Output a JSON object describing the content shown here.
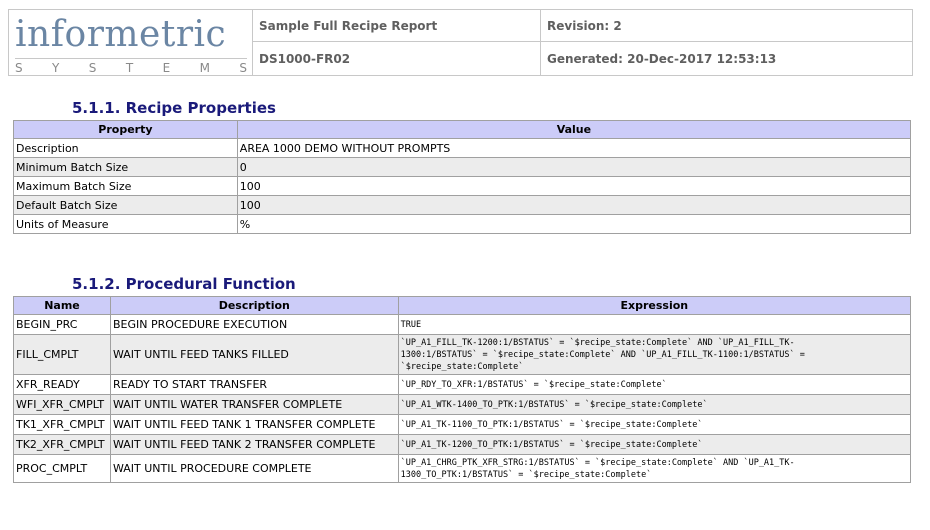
{
  "header": {
    "logo_word": "informetric",
    "logo_sub": [
      "S",
      "Y",
      "S",
      "T",
      "E",
      "M",
      "S"
    ],
    "report_title": "Sample Full Recipe Report",
    "revision": "Revision: 2",
    "doc_id": "DS1000-FR02",
    "generated": "Generated: 20-Dec-2017 12:53:13"
  },
  "recipe_properties": {
    "title": "5.1.1.  Recipe Properties",
    "columns": [
      "Property",
      "Value"
    ],
    "rows": [
      {
        "property": "Description",
        "value": "AREA 1000 DEMO WITHOUT PROMPTS"
      },
      {
        "property": "Minimum Batch Size",
        "value": "0"
      },
      {
        "property": "Maximum Batch Size",
        "value": "100"
      },
      {
        "property": "Default Batch Size",
        "value": "100"
      },
      {
        "property": "Units of Measure",
        "value": "%"
      }
    ]
  },
  "procedural_function": {
    "title": "5.1.2.  Procedural Function",
    "columns": [
      "Name",
      "Description",
      "Expression"
    ],
    "rows": [
      {
        "name": "BEGIN_PRC",
        "description": "BEGIN PROCEDURE EXECUTION",
        "expression": "TRUE"
      },
      {
        "name": "FILL_CMPLT",
        "description": "WAIT UNTIL FEED TANKS FILLED",
        "expression_lines": [
          "`UP_A1_FILL_TK-1200:1/BSTATUS` = `$recipe_state:Complete` AND `UP_A1_FILL_TK-",
          "1300:1/BSTATUS` = `$recipe_state:Complete` AND `UP_A1_FILL_TK-1100:1/BSTATUS` =",
          "`$recipe_state:Complete`"
        ]
      },
      {
        "name": "XFR_READY",
        "description": "READY TO START TRANSFER",
        "expression": "`UP_RDY_TO_XFR:1/BSTATUS` = `$recipe_state:Complete`"
      },
      {
        "name": "WFI_XFR_CMPLT",
        "description": "WAIT UNTIL WATER TRANSFER COMPLETE",
        "expression": "`UP_A1_WTK-1400_TO_PTK:1/BSTATUS` = `$recipe_state:Complete`"
      },
      {
        "name": "TK1_XFR_CMPLT",
        "description": "WAIT UNTIL FEED TANK 1 TRANSFER COMPLETE",
        "expression": "`UP_A1_TK-1100_TO_PTK:1/BSTATUS` = `$recipe_state:Complete`"
      },
      {
        "name": "TK2_XFR_CMPLT",
        "description": "WAIT UNTIL FEED TANK 2 TRANSFER COMPLETE",
        "expression": "`UP_A1_TK-1200_TO_PTK:1/BSTATUS` = `$recipe_state:Complete`"
      },
      {
        "name": "PROC_CMPLT",
        "description": "WAIT UNTIL PROCEDURE COMPLETE",
        "expression_lines": [
          "`UP_A1_CHRG_PTK_XFR_STRG:1/BSTATUS` = `$recipe_state:Complete` AND `UP_A1_TK-",
          "1300_TO_PTK:1/BSTATUS` = `$recipe_state:Complete`"
        ]
      }
    ]
  }
}
